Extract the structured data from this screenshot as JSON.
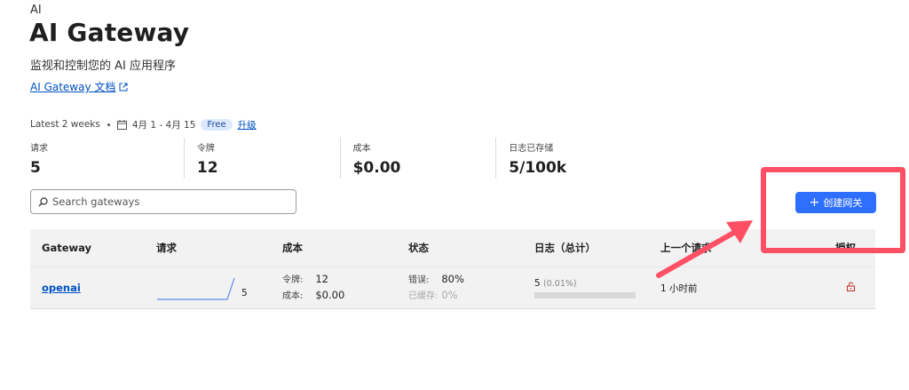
{
  "breadcrumb": "AI",
  "page": {
    "title": "AI Gateway",
    "subtitle": "监视和控制您的 AI 应用程序",
    "doc_link": "AI Gateway 文档"
  },
  "range": {
    "period": "Latest 2 weeks",
    "dates": "4月 1 - 4月 15",
    "plan_badge": "Free",
    "upgrade": "升级"
  },
  "stats": [
    {
      "label": "请求",
      "value": "5"
    },
    {
      "label": "令牌",
      "value": "12"
    },
    {
      "label": "成本",
      "value": "$0.00"
    },
    {
      "label": "日志已存储",
      "value": "5/100k"
    }
  ],
  "search": {
    "placeholder": "Search gateways"
  },
  "create_button": {
    "label": "创建网关"
  },
  "table": {
    "headers": [
      "Gateway",
      "请求",
      "成本",
      "状态",
      "日志（总计）",
      "上一个请求",
      "授权"
    ],
    "rows": [
      {
        "gateway": "openai",
        "requests": "5",
        "tokens_label": "令牌:",
        "tokens": "12",
        "cost_label": "成本:",
        "cost": "$0.00",
        "errors_label": "错误:",
        "errors": "80%",
        "cached_label": "已缓存:",
        "cached": "0%",
        "logs": "5",
        "logs_pct": "(0.01%)",
        "last_request": "1 小时前"
      }
    ]
  },
  "colors": {
    "accent": "#2f6fff",
    "link": "#0051c3",
    "highlight": "#ff4f64",
    "lock": "#c0392b"
  }
}
